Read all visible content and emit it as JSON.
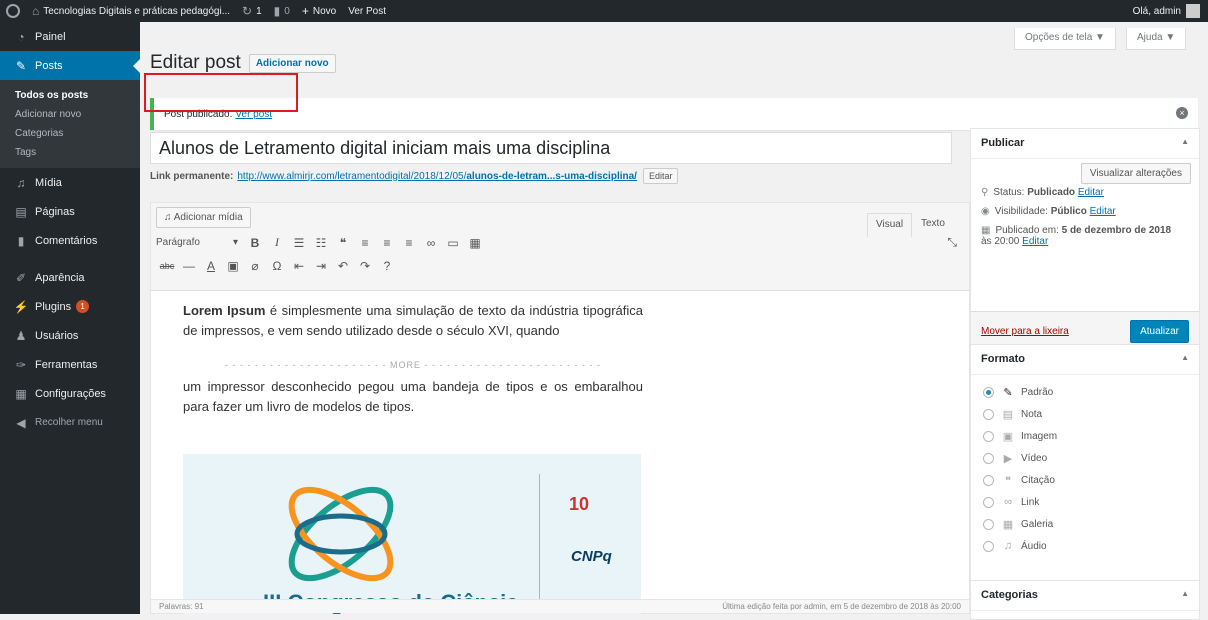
{
  "adminbar": {
    "site_name": "Tecnologias Digitais e práticas pedagógi...",
    "updates_count": "1",
    "comments_count": "0",
    "new_label": "Novo",
    "view_post_label": "Ver Post",
    "greeting": "Olá, admin"
  },
  "sidebar": {
    "painel": "Painel",
    "posts": "Posts",
    "posts_sub": [
      "Todos os posts",
      "Adicionar novo",
      "Categorias",
      "Tags"
    ],
    "midia": "Mídia",
    "paginas": "Páginas",
    "comentarios": "Comentários",
    "aparencia": "Aparência",
    "plugins": "Plugins",
    "plugins_badge": "1",
    "usuarios": "Usuários",
    "ferramentas": "Ferramentas",
    "configuracoes": "Configurações",
    "recolher": "Recolher menu"
  },
  "screen_options": "Opções de tela ▼",
  "help": "Ajuda ▼",
  "page_title": "Editar post",
  "add_new": "Adicionar novo",
  "notice": {
    "text": "Post publicado.",
    "link": "Ver post"
  },
  "post_title": "Alunos de Letramento digital iniciam mais uma disciplina",
  "permalink": {
    "label": "Link permanente:",
    "url_prefix": "http://www.almirjr.com/letramentodigital/2018/12/05/",
    "url_slug": "alunos-de-letram...s-uma-disciplina/",
    "edit": "Editar"
  },
  "editor": {
    "add_media": "Adicionar mídia",
    "tab_visual": "Visual",
    "tab_text": "Texto",
    "format_select": "Parágrafo",
    "para1_bold": "Lorem Ipsum",
    "para1": " é simplesmente uma simulação de texto da indústria tipográfica  de impressos, e vem sendo utilizado desde o século XVI, quando",
    "more": "MORE",
    "para2": "um impressor desconhecido pegou uma bandeja de tipos e os embaralhou para fazer um livro de modelos de tipos.",
    "word_count": "Palavras: 91",
    "last_edit": "Última edição feita por admin, em 5 de dezembro de 2018 às 20:00",
    "image_text_cnpq": "CNPq",
    "image_text_congress": "III Congresso de Ciência",
    "image_text_ten": "10"
  },
  "publish": {
    "title": "Publicar",
    "preview": "Visualizar alterações",
    "status_label": "Status:",
    "status_value": "Publicado",
    "visibility_label": "Visibilidade:",
    "visibility_value": "Público",
    "published_label": "Publicado em:",
    "published_value": "5 de dezembro de 2018",
    "published_time": "às 20:00",
    "edit": "Editar",
    "trash": "Mover para a lixeira",
    "update": "Atualizar"
  },
  "format": {
    "title": "Formato",
    "options": [
      "Padrão",
      "Nota",
      "Imagem",
      "Vídeo",
      "Citação",
      "Link",
      "Galeria",
      "Áudio"
    ],
    "selected": "Padrão"
  },
  "categories": {
    "title": "Categorias"
  }
}
